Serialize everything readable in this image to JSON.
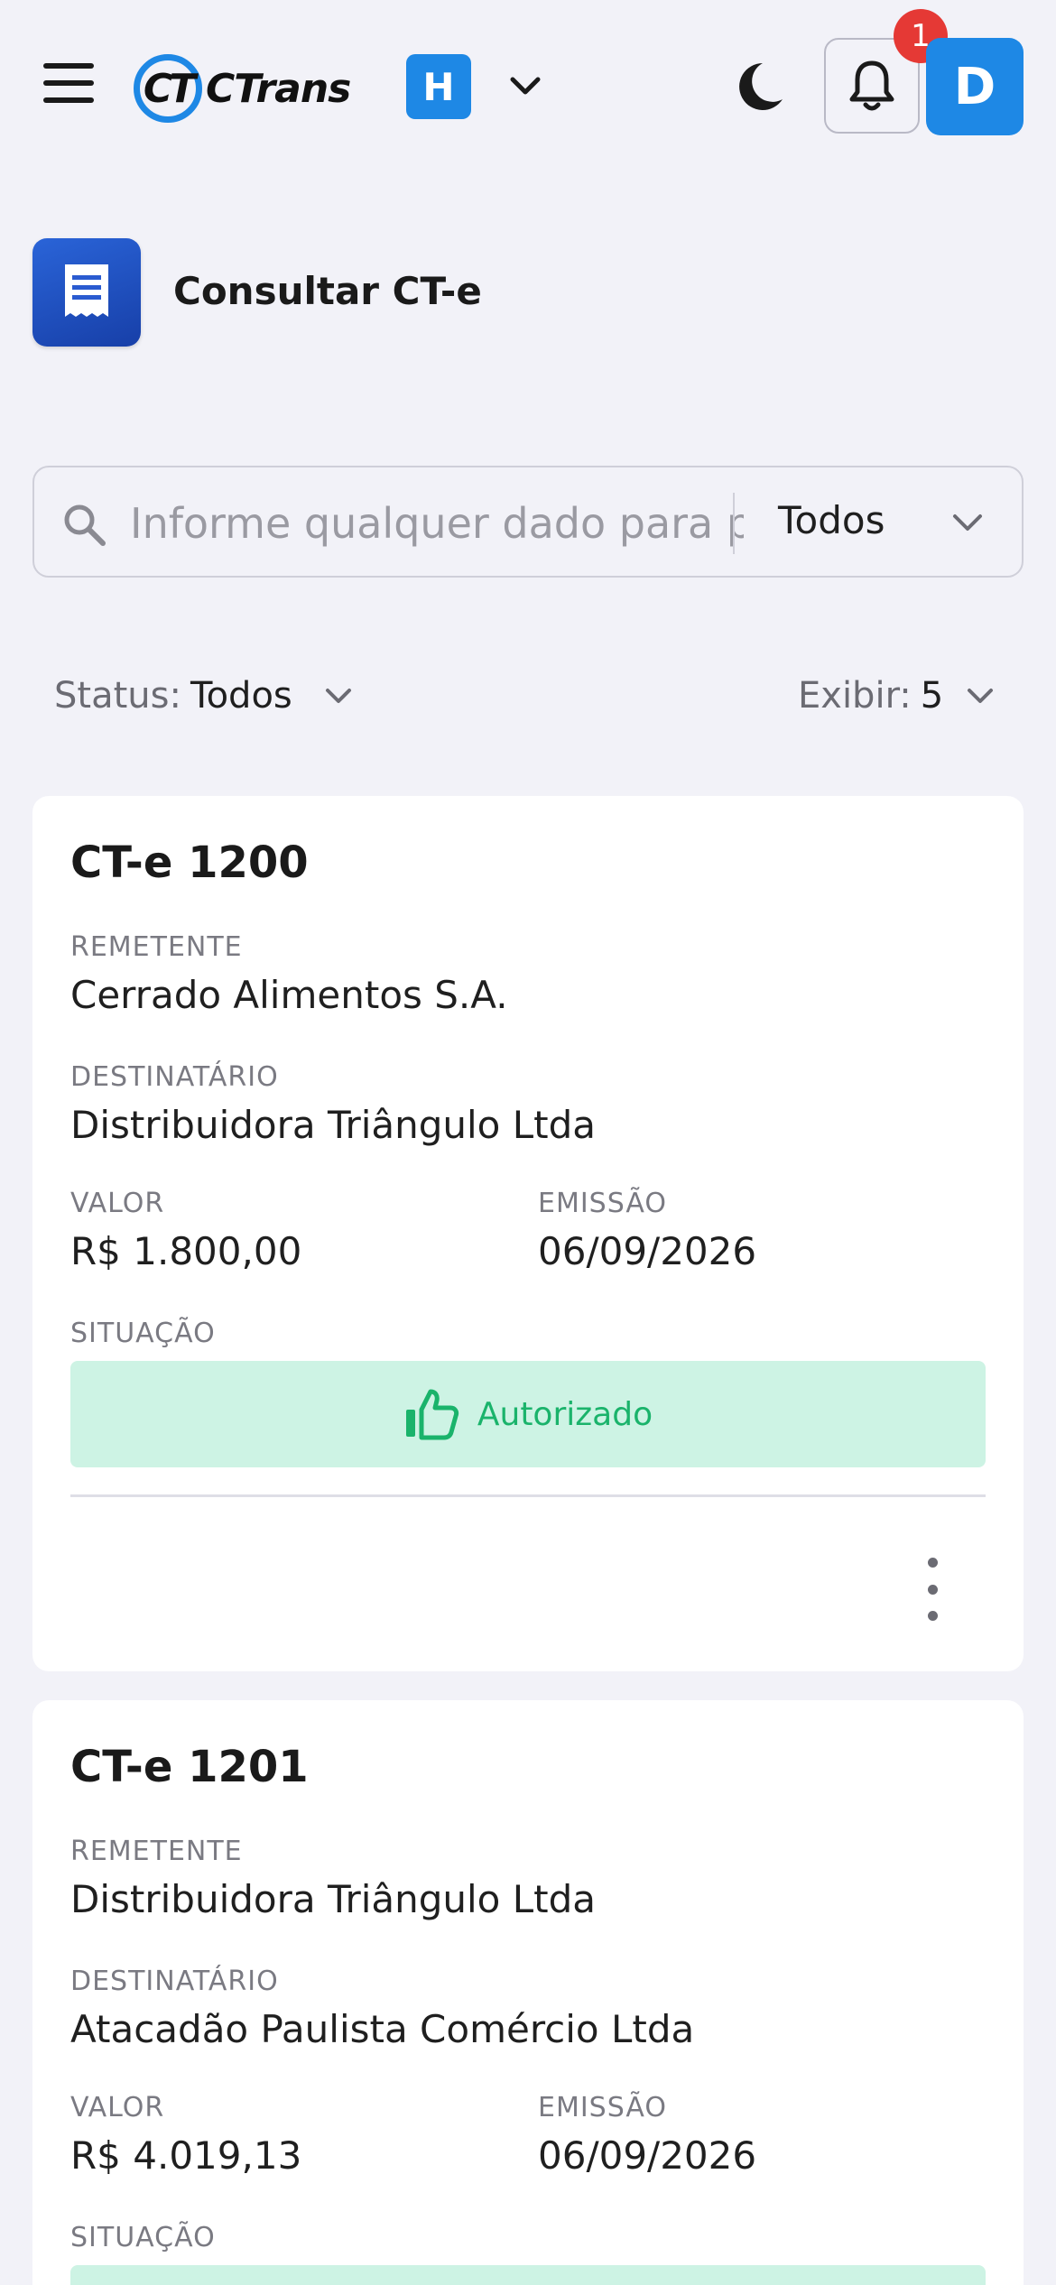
{
  "header": {
    "logo_text": "CTrans",
    "logo_mark": "CT",
    "company_initial": "H",
    "notification_count": "1",
    "user_initial": "D",
    "icons": [
      "menu-icon",
      "chevron-down-icon",
      "moon-icon",
      "bell-icon"
    ]
  },
  "page": {
    "title": "Consultar CT-e",
    "icon": "receipt-icon"
  },
  "search": {
    "placeholder": "Informe qualquer dado para pesquisar",
    "value": "",
    "select_value": "Todos"
  },
  "filters": {
    "status_label": "Status:",
    "status_value": "Todos",
    "exibir_label": "Exibir:",
    "exibir_value": "5"
  },
  "labels": {
    "remetente": "REMETENTE",
    "destinatario": "DESTINATÁRIO",
    "valor": "VALOR",
    "emissao": "EMISSÃO",
    "situacao": "SITUAÇÃO"
  },
  "cards": [
    {
      "title": "CT-e 1200",
      "remetente": "Cerrado Alimentos S.A.",
      "destinatario": "Distribuidora Triângulo Ltda",
      "valor": "R$ 1.800,00",
      "emissao": "06/09/2026",
      "situacao": "Autorizado"
    },
    {
      "title": "CT-e 1201",
      "remetente": "Distribuidora Triângulo Ltda",
      "destinatario": "Atacadão Paulista Comércio Ltda",
      "valor": "R$ 4.019,13",
      "emissao": "06/09/2026",
      "situacao": ""
    }
  ],
  "colors": {
    "primary": "#1e88e5",
    "background": "#f2f2f8",
    "status_authorized_bg": "#cdf3e4",
    "status_authorized_text": "#1ab36b",
    "badge": "#e53935"
  }
}
